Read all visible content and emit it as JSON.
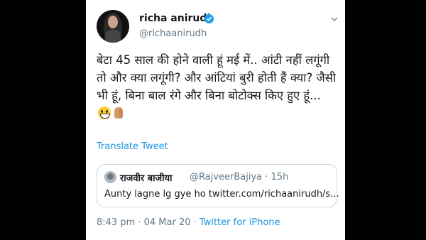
{
  "author": {
    "name": "richa anirudh",
    "handle": "@richaanirudh",
    "verified": true
  },
  "tweet": {
    "text": "बेटा 45 साल की होने वाली हूं मई में.. आंटी नहीं लगूंगी तो और क्या लगूंगी? और आंटियां बुरी होती हैं क्या? जैसी भी हूं, बिना बाल रंगे और बिना बोटोक्स किए हुए हूं...",
    "emojis": [
      "grinning-face",
      "folded-hands-medium-skin"
    ],
    "translate_label": "Translate Tweet"
  },
  "quoted": {
    "name": "राजवीर बाजीया",
    "handle": "@RajveerBajiya · 15h",
    "text": "Aunty lagne lg gye ho twitter.com/richaanirudh/s..."
  },
  "meta": {
    "time": "8:43 pm · 04 Mar 20 · ",
    "source": "Twitter for iPhone"
  },
  "colors": {
    "link": "#1b95e0",
    "verified": "#1da1f2",
    "secondary_text": "#657786"
  }
}
